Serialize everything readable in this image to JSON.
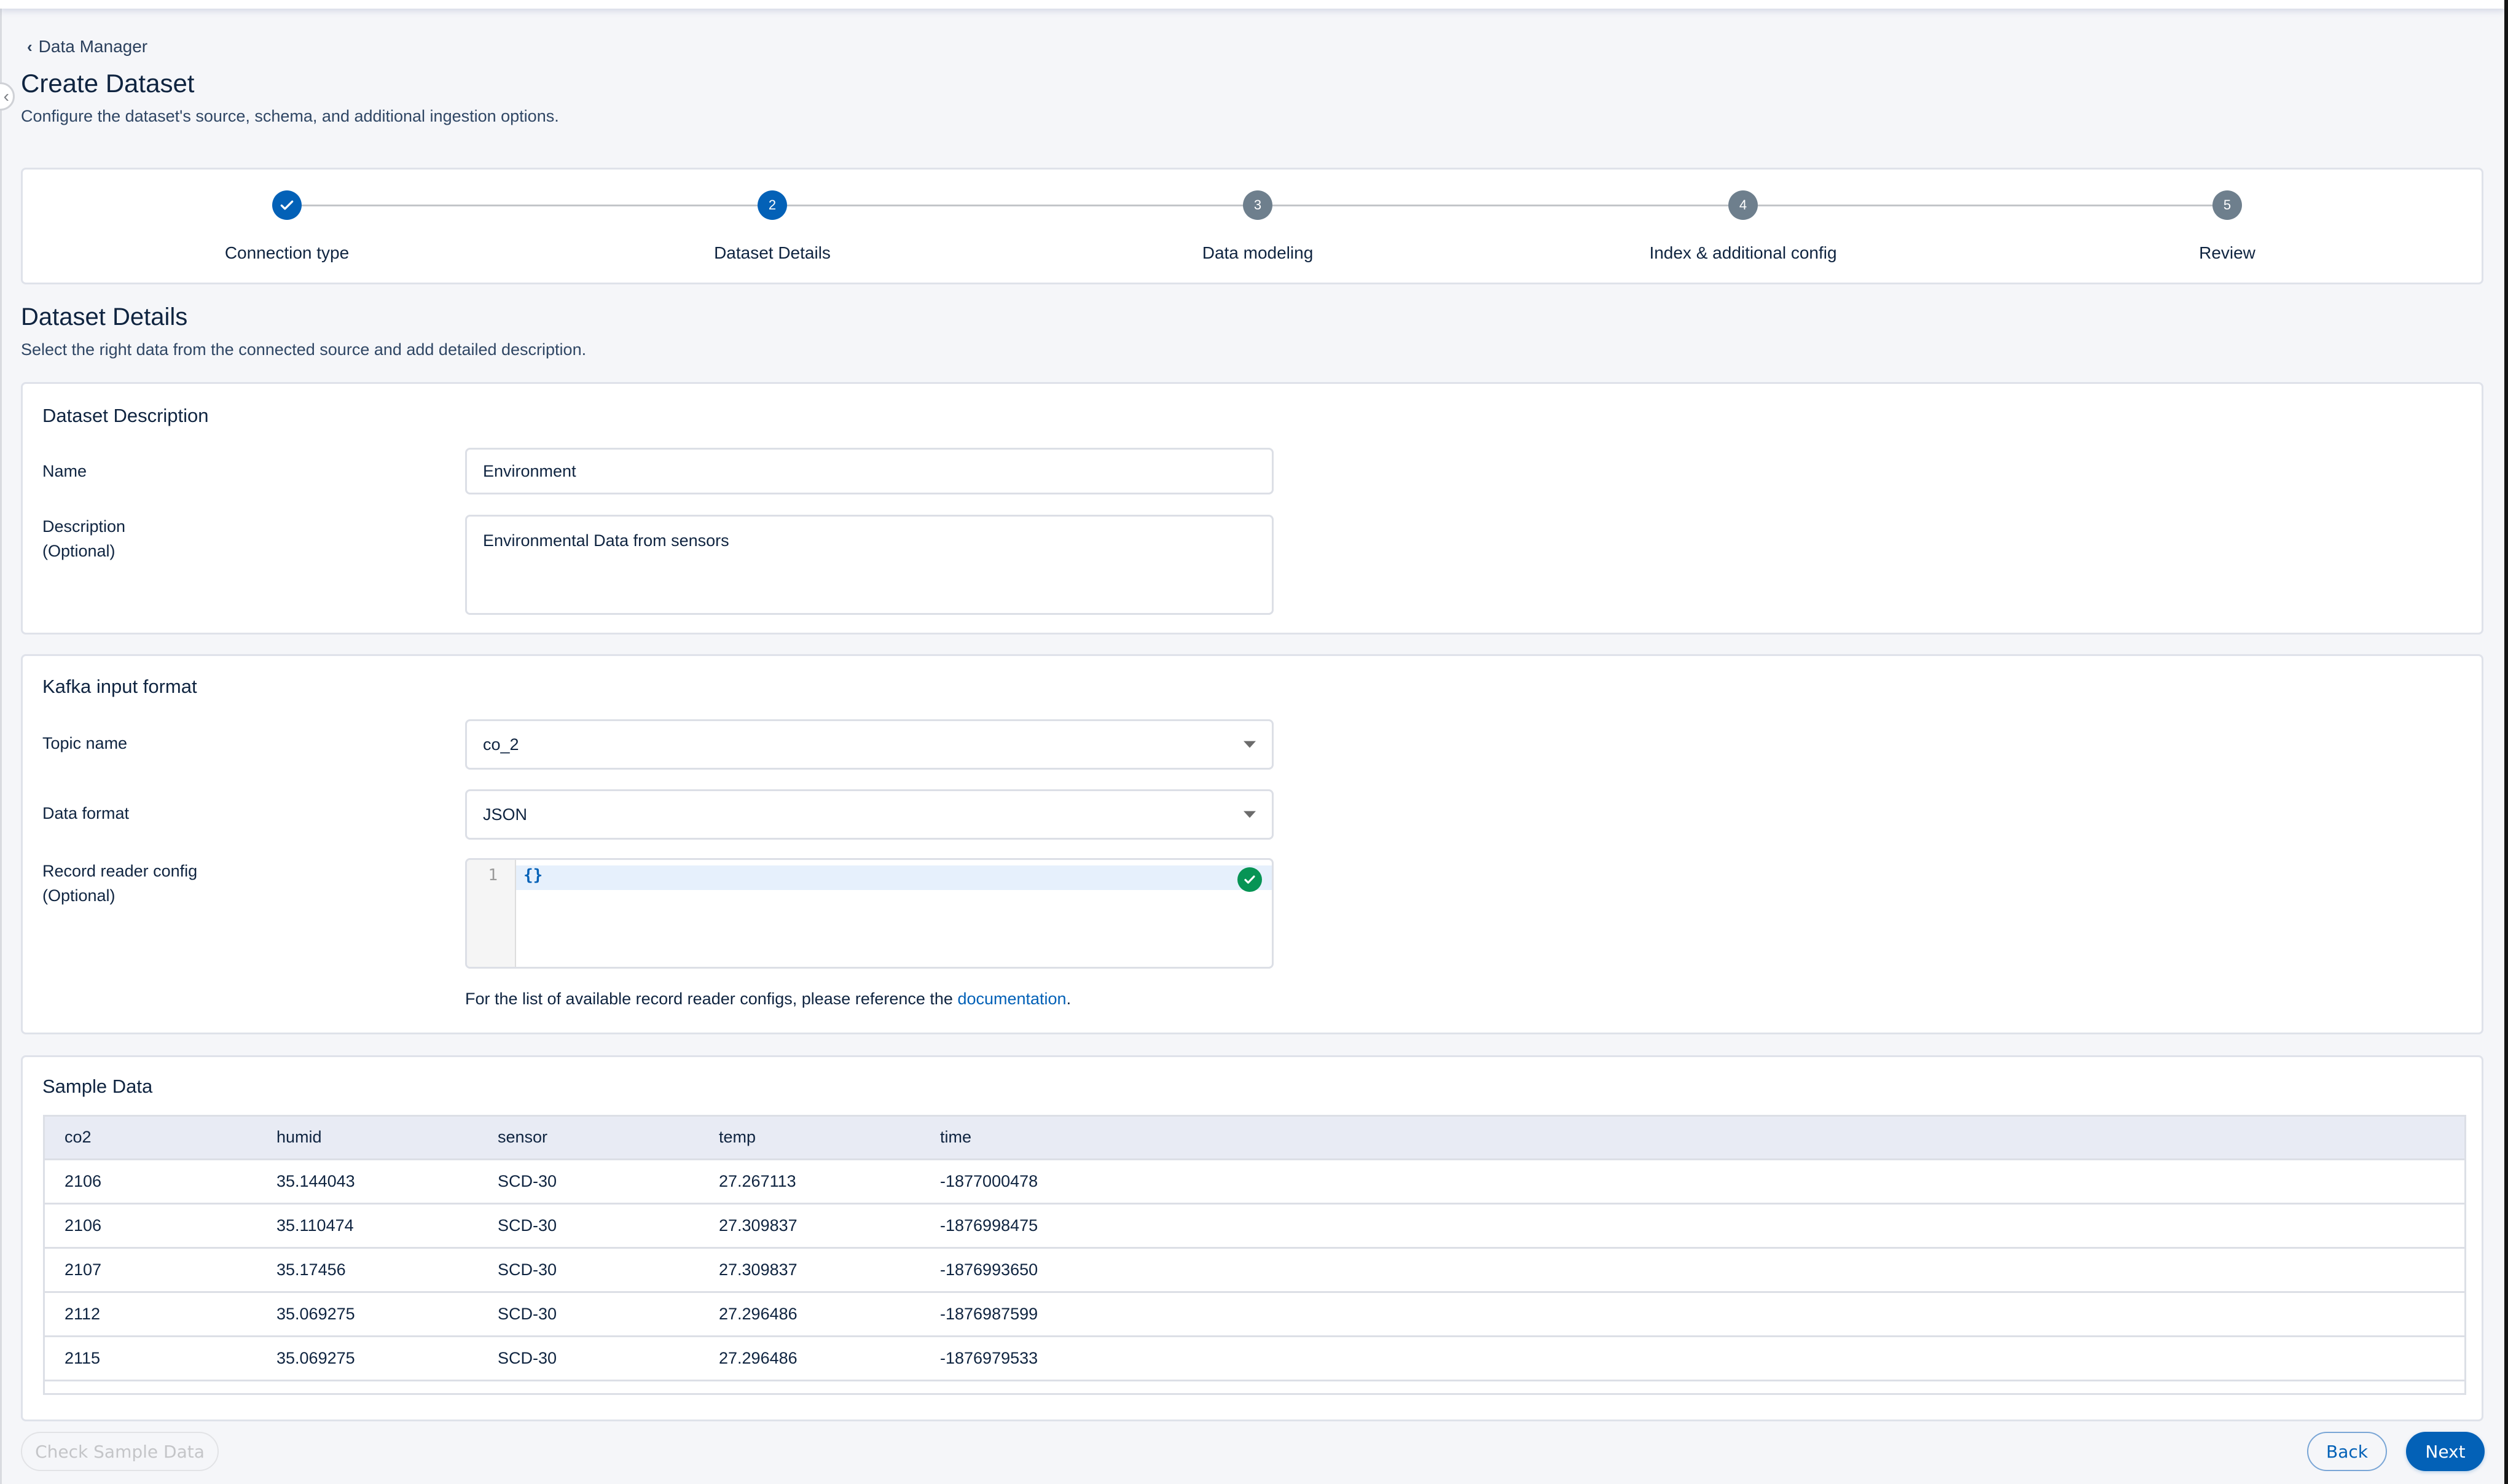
{
  "breadcrumb": {
    "back_label": "Data Manager",
    "icon": "chevron-left-icon"
  },
  "page": {
    "title": "Create Dataset",
    "subtitle": "Configure the dataset's source, schema, and additional ingestion options."
  },
  "stepper": {
    "steps": [
      {
        "number": "1",
        "label": "Connection type",
        "status": "completed"
      },
      {
        "number": "2",
        "label": "Dataset Details",
        "status": "active"
      },
      {
        "number": "3",
        "label": "Data modeling",
        "status": "pending"
      },
      {
        "number": "4",
        "label": "Index & additional config",
        "status": "pending"
      },
      {
        "number": "5",
        "label": "Review",
        "status": "pending"
      }
    ]
  },
  "section": {
    "title": "Dataset Details",
    "subtitle": "Select the right data from the connected source and add detailed description."
  },
  "dataset_description": {
    "title": "Dataset Description",
    "name_label": "Name",
    "name_value": "Environment",
    "description_label": "Description",
    "description_optional": "(Optional)",
    "description_value": "Environmental Data from sensors"
  },
  "kafka": {
    "title": "Kafka input format",
    "topic_label": "Topic name",
    "topic_value": "co_2",
    "format_label": "Data format",
    "format_value": "JSON",
    "config_label": "Record reader config",
    "config_optional": "(Optional)",
    "config_line_number": "1",
    "config_code": "{}",
    "config_status": "valid",
    "help_prefix": "For the list of available record reader configs, please reference the ",
    "help_link": "documentation",
    "help_suffix": "."
  },
  "sample_data": {
    "title": "Sample Data",
    "columns": [
      "co2",
      "humid",
      "sensor",
      "temp",
      "time"
    ],
    "rows": [
      [
        "2106",
        "35.144043",
        "SCD-30",
        "27.267113",
        "-1877000478"
      ],
      [
        "2106",
        "35.110474",
        "SCD-30",
        "27.309837",
        "-1876998475"
      ],
      [
        "2107",
        "35.17456",
        "SCD-30",
        "27.309837",
        "-1876993650"
      ],
      [
        "2112",
        "35.069275",
        "SCD-30",
        "27.296486",
        "-1876987599"
      ],
      [
        "2115",
        "35.069275",
        "SCD-30",
        "27.296486",
        "-1876979533"
      ]
    ]
  },
  "footer": {
    "check_sample_label": "Check Sample Data",
    "back_label": "Back",
    "next_label": "Next"
  },
  "colors": {
    "primary": "#0361b7",
    "pending_step": "#6e7f8d",
    "success": "#079455",
    "background": "#f5f6f9"
  }
}
